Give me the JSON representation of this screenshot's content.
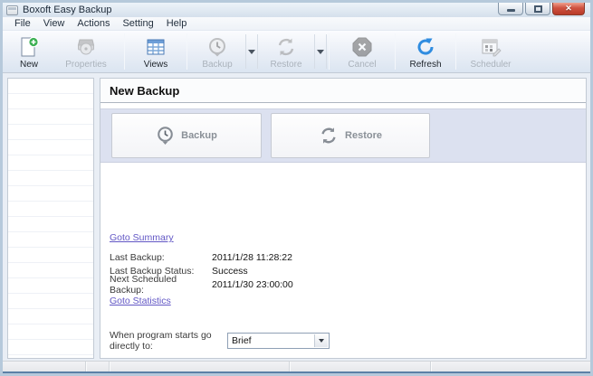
{
  "window": {
    "title": "Boxoft Easy Backup"
  },
  "menubar": {
    "items": [
      "File",
      "View",
      "Actions",
      "Setting",
      "Help"
    ]
  },
  "toolbar": {
    "buttons": [
      {
        "label": "New",
        "icon": "new-document-icon",
        "enabled": true
      },
      {
        "label": "Properties",
        "icon": "properties-icon",
        "enabled": false
      },
      {
        "label": "Views",
        "icon": "views-grid-icon",
        "enabled": true
      },
      {
        "label": "Backup",
        "icon": "backup-clock-icon",
        "enabled": false,
        "has_dropdown": true
      },
      {
        "label": "Restore",
        "icon": "restore-arrows-icon",
        "enabled": false,
        "has_dropdown": true
      },
      {
        "label": "Cancel",
        "icon": "cancel-octagon-icon",
        "enabled": false
      },
      {
        "label": "Refresh",
        "icon": "refresh-arrow-icon",
        "enabled": true
      },
      {
        "label": "Scheduler",
        "icon": "scheduler-calendar-icon",
        "enabled": false
      }
    ]
  },
  "main": {
    "title": "New Backup",
    "action_buttons": [
      {
        "label": "Backup",
        "icon": "backup-clock-icon"
      },
      {
        "label": "Restore",
        "icon": "restore-arrows-icon"
      }
    ],
    "links": {
      "summary": "Goto Summary",
      "statistics": "Goto Statistics"
    },
    "info_rows": [
      {
        "label": "Last Backup:",
        "value": "2011/1/28 11:28:22"
      },
      {
        "label": "Last Backup Status:",
        "value": "Success"
      },
      {
        "label": "Next Scheduled Backup:",
        "value": "2011/1/30 23:00:00"
      }
    ],
    "startup": {
      "label": "When program starts go directly to:",
      "selected": "Brief"
    }
  },
  "colors": {
    "accent_blue": "#2f8ce0",
    "link": "#6257c5",
    "strip_lavender": "#dce1f0",
    "close_red": "#cf5240",
    "new_badge_green": "#3db054"
  }
}
